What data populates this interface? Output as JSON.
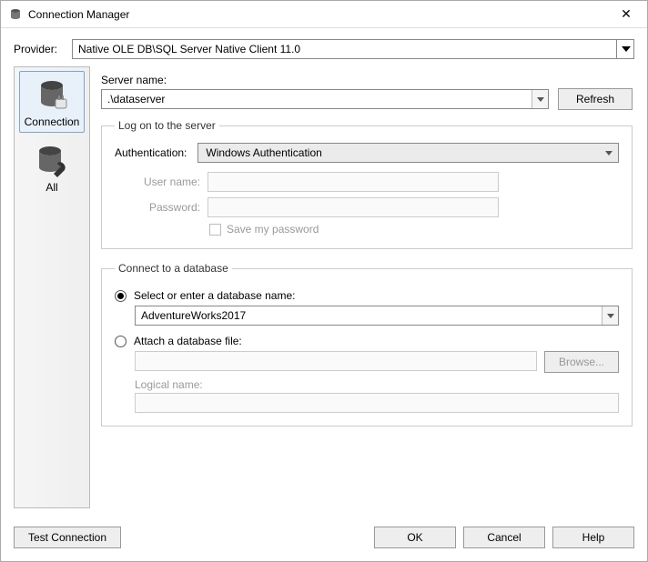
{
  "window": {
    "title": "Connection Manager"
  },
  "provider": {
    "label": "Provider:",
    "value": "Native OLE DB\\SQL Server Native Client 11.0"
  },
  "sidebar": {
    "items": [
      {
        "label": "Connection",
        "selected": true
      },
      {
        "label": "All",
        "selected": false
      }
    ]
  },
  "server": {
    "label": "Server name:",
    "value": ".\\dataserver",
    "refresh": "Refresh"
  },
  "logon": {
    "legend": "Log on to the server",
    "auth_label": "Authentication:",
    "auth_value": "Windows Authentication",
    "username_label": "User name:",
    "username_value": "",
    "password_label": "Password:",
    "password_value": "",
    "save_pw_label": "Save my password"
  },
  "database": {
    "legend": "Connect to a database",
    "opt_select_label": "Select or enter a database name:",
    "db_value": "AdventureWorks2017",
    "opt_attach_label": "Attach a database file:",
    "attach_value": "",
    "browse_label": "Browse...",
    "logical_label": "Logical name:",
    "logical_value": ""
  },
  "footer": {
    "test": "Test Connection",
    "ok": "OK",
    "cancel": "Cancel",
    "help": "Help"
  }
}
